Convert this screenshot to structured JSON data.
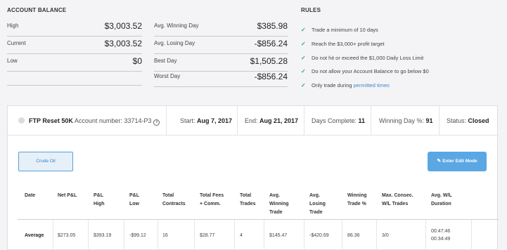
{
  "account_balance": {
    "title": "ACCOUNT BALANCE",
    "left": [
      {
        "label": "High",
        "value": "$3,003.52"
      },
      {
        "label": "Current",
        "value": "$3,003.52"
      },
      {
        "label": "Low",
        "value": "$0"
      }
    ],
    "right": [
      {
        "label": "Avg. Winning Day",
        "value": "$385.98"
      },
      {
        "label": "Avg. Losing Day",
        "value": "-$856.24"
      },
      {
        "label": "Best Day",
        "value": "$1,505.28"
      },
      {
        "label": "Worst Day",
        "value": "-$856.24"
      }
    ]
  },
  "rules": {
    "title": "RULES",
    "items": [
      {
        "text": "Trade a minimum of 10 days"
      },
      {
        "text": "Reach the $3,000+ profit target"
      },
      {
        "text": "Do not hit or exceed the $1,000 Daily Loss Limit"
      },
      {
        "text": "Do not allow your Account Balance to go below $0"
      },
      {
        "text": "Only trade during ",
        "link": "permitted times"
      }
    ],
    "check_color": "#3aa36b",
    "link_color": "#3e86c9"
  },
  "account_bar": {
    "name": "FTP Reset 50K",
    "account_number_label": "Account number:",
    "account_number": "33714-P3",
    "start_label": "Start:",
    "start": "Aug 7, 2017",
    "end_label": "End:",
    "end": "Aug 21, 2017",
    "days_label": "Days Complete:",
    "days": "11",
    "winning_label": "Winning Day %:",
    "winning": "91",
    "status_label": "Status:",
    "status": "Closed"
  },
  "buttons": {
    "instrument": "Crude Oil",
    "edit_mode": "Enter Edit Mode",
    "accent": "#5aa7e4"
  },
  "table": {
    "headers": [
      [
        "Date"
      ],
      [
        "Net P&L"
      ],
      [
        "P&L",
        "High"
      ],
      [
        "P&L",
        "Low"
      ],
      [
        "Total",
        "Contracts"
      ],
      [
        "Total Fees",
        "+ Comm."
      ],
      [
        "Total",
        "Trades"
      ],
      [
        "Avg.",
        "Winning",
        "Trade"
      ],
      [
        "Avg.",
        "Losing",
        "Trade"
      ],
      [
        "Winning",
        "Trade %"
      ],
      [
        "Max. Consec.",
        "W/L Trades"
      ],
      [
        "Avg. W/L",
        "Duration"
      ]
    ],
    "row": {
      "date": "Average",
      "net_pl": "$273.05",
      "pl_high": "$393.19",
      "pl_low": "-$99.12",
      "contracts": "16",
      "fees": "$28.77",
      "trades": "4",
      "avg_win": "$145.47",
      "avg_loss": "-$420.69",
      "win_pct": "86.36",
      "max_consec": "3/0",
      "duration_win": "00:47:46",
      "duration_loss": "00:34:49"
    }
  }
}
